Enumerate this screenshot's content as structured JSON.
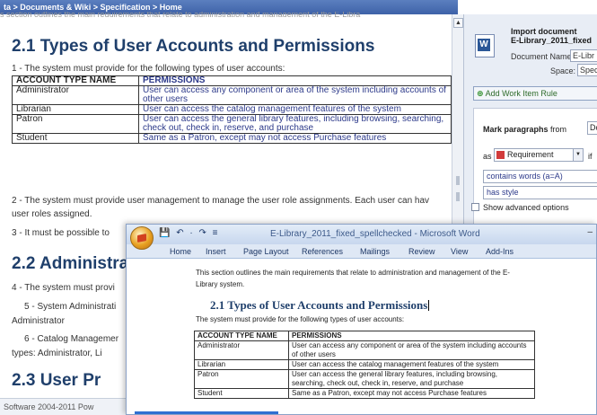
{
  "breadcrumb": {
    "text": "ta > Documents & Wiki > Specification > Home",
    "ghost_text": "s section outlines the main requirements that relate to administration and management of the E-Libra"
  },
  "doc": {
    "heading1": "2.1 Types of User Accounts and Permissions",
    "req1_num": "1",
    "req1_text": " - The system must provide for the following types of user accounts:",
    "table": {
      "headers": [
        "ACCOUNT TYPE NAME",
        "PERMISSIONS"
      ],
      "rows": [
        [
          "Administrator",
          "User can access any component or area of the system including accounts of other users"
        ],
        [
          "Librarian",
          "User can access the catalog management features of the system"
        ],
        [
          "Patron",
          "User can access the general library features, including browsing, searching, check out, check in, reserve, and purchase"
        ],
        [
          "Student",
          "Same as a Patron, except may not access Purchase features"
        ]
      ]
    },
    "req2_num": "2",
    "req2_text": " - The system must provide user management to manage the user role assignments. Each user can hav",
    "req2_text_line2": "user roles assigned.",
    "req3_num": "3",
    "req3_text": " - It must be possible to",
    "heading2": "2.2 Administrat",
    "req4_num": "4",
    "req4_text": " - The system must provi",
    "req5_num": "5",
    "req5_text": " - System Administrati",
    "req5_text_line2": "Administrator",
    "req6_num": "6",
    "req6_text": " - Catalog Managemer",
    "req6_text_line2": "types: Administrator, Li",
    "cut_heading": "2.3 User Pr"
  },
  "panel": {
    "import_title": "Import document",
    "import_filename": "E-Library_2011_fixed",
    "doc_name_label": "Document Name:",
    "doc_name_value": "E-Libr",
    "space_label": "Space:",
    "space_value": "Spec",
    "add_work_item": "Add Work Item Rule",
    "mark_label": "Mark paragraphs",
    "mark_from": "from",
    "mark_select": "Doc",
    "as_label": "as",
    "as_value": "Requirement",
    "if_label": "if",
    "cond1": "contains words (a=A)",
    "cond2": "has style",
    "advanced": "Show advanced options"
  },
  "statusbar": {
    "text": "Software 2004-2011    Pow"
  },
  "word": {
    "caption": "E-Library_2011_fixed_spellchecked - Microsoft Word",
    "qat": "💾 ↶ · ↷ ≡",
    "tabs": [
      "Home",
      "Insert",
      "Page Layout",
      "References",
      "Mailings",
      "Review",
      "View",
      "Add-Ins"
    ],
    "intro_line1": "This section outlines the main requirements that relate to administration and management of the E-",
    "intro_line2": "Library system.",
    "heading": "2.1 Types of User Accounts and Permissions",
    "lead": "The system must provide for the following types of user accounts:",
    "table": {
      "headers": [
        "ACCOUNT TYPE NAME",
        "PERMISSIONS"
      ],
      "rows": [
        [
          "Administrator",
          "User can access any component or area of the system including accounts of other users"
        ],
        [
          "Librarian",
          "User can access the catalog management features of the system"
        ],
        [
          "Patron",
          "User can access the general library features, including browsing, searching, check out, check in, reserve, and purchase"
        ],
        [
          "Student",
          "Same as a Patron, except may not access Purchase features"
        ]
      ]
    }
  }
}
